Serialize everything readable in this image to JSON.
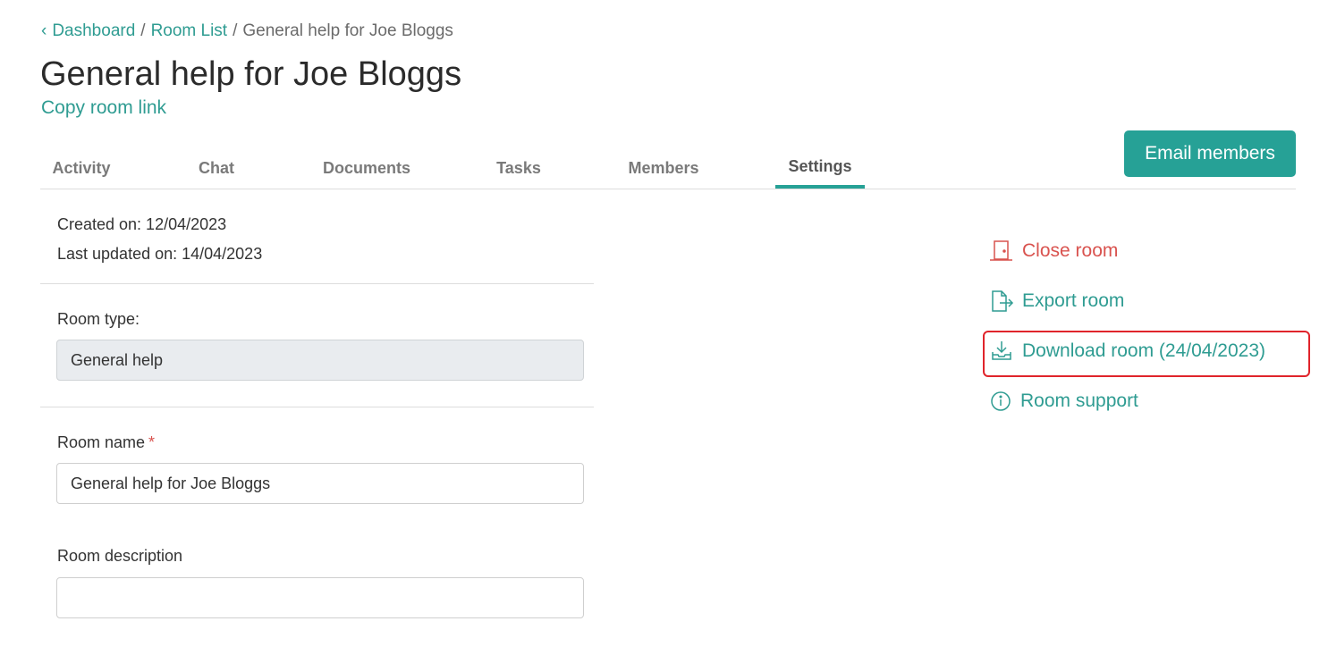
{
  "breadcrumb": {
    "items": [
      "Dashboard",
      "Room List"
    ],
    "current": "General help for Joe Bloggs",
    "separator": "/"
  },
  "header": {
    "title": "General help for Joe Bloggs",
    "copy_link": "Copy room link",
    "email_button": "Email members"
  },
  "tabs": [
    {
      "label": "Activity"
    },
    {
      "label": "Chat"
    },
    {
      "label": "Documents"
    },
    {
      "label": "Tasks"
    },
    {
      "label": "Members"
    },
    {
      "label": "Settings",
      "active": true
    }
  ],
  "settings": {
    "created": "Created on: 12/04/2023",
    "updated": "Last updated on: 14/04/2023",
    "room_type_label": "Room type:",
    "room_type_value": "General help",
    "room_name_label": "Room name",
    "required_mark": "*",
    "room_name_value": "General help for Joe Bloggs",
    "room_description_label": "Room description",
    "room_description_value": ""
  },
  "actions": {
    "close": "Close room",
    "export": "Export room",
    "download": "Download room (24/04/2023)",
    "support": "Room support"
  },
  "colors": {
    "accent": "#26a196",
    "link": "#2f9c92",
    "danger": "#d9534f",
    "highlight": "#e0242b"
  },
  "icons": {
    "breadcrumb_back": "chevron-left-icon",
    "close": "door-icon",
    "export": "file-export-icon",
    "download": "download-tray-icon",
    "support": "info-circle-icon"
  }
}
